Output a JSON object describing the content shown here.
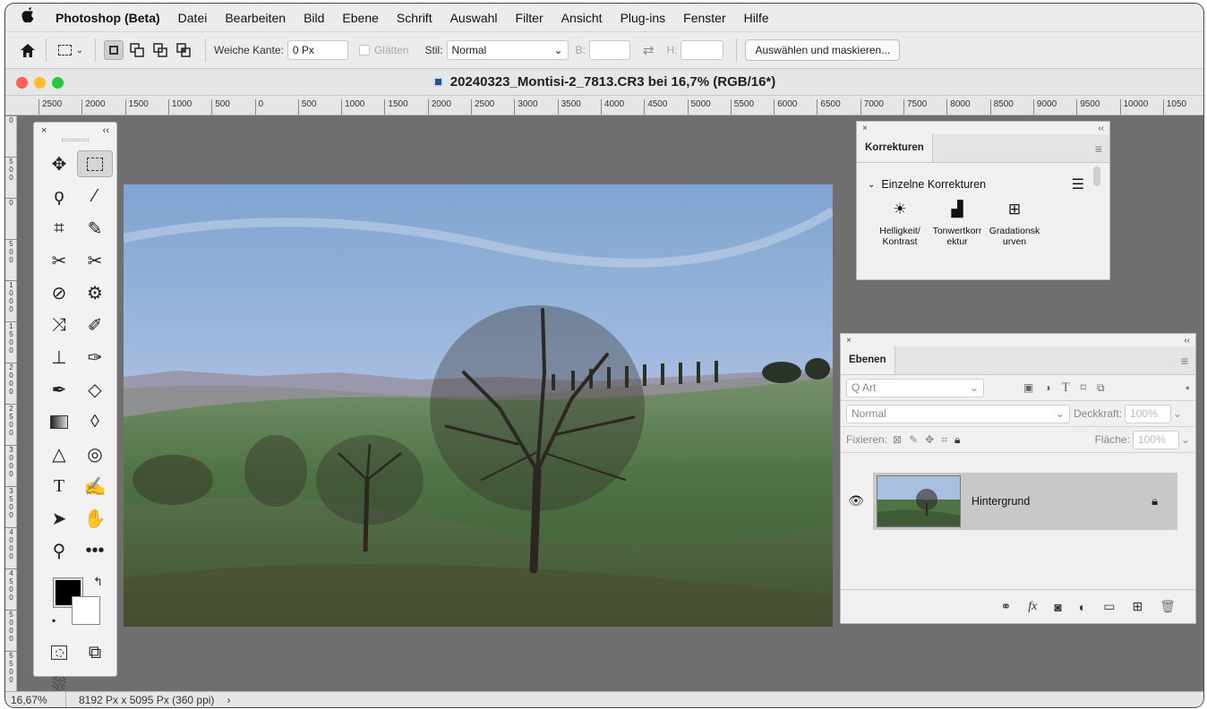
{
  "menubar": {
    "app_name": "Photoshop (Beta)",
    "items": [
      "Datei",
      "Bearbeiten",
      "Bild",
      "Ebene",
      "Schrift",
      "Auswahl",
      "Filter",
      "Ansicht",
      "Plug-ins",
      "Fenster",
      "Hilfe"
    ]
  },
  "options": {
    "soft_edge_label": "Weiche Kante:",
    "soft_edge_value": "0 Px",
    "antialias_label": "Glätten",
    "style_label": "Stil:",
    "style_value": "Normal",
    "width_label": "B:",
    "height_label": "H:",
    "select_mask_button": "Auswählen und maskieren..."
  },
  "document": {
    "title": "20240323_Montisi-2_7813.CR3 bei 16,7% (RGB/16*)"
  },
  "ruler": {
    "h": [
      "2500",
      "2000",
      "1500",
      "1000",
      "500",
      "0",
      "500",
      "1000",
      "1500",
      "2000",
      "2500",
      "3000",
      "3500",
      "4000",
      "4500",
      "5000",
      "5500",
      "6000",
      "6500",
      "7000",
      "7500",
      "8000",
      "8500",
      "9000",
      "9500",
      "10000",
      "1050"
    ],
    "v": [
      "0",
      "5\n0\n0",
      "0",
      "5\n0\n0",
      "1\n0\n0\n0",
      "1\n5\n0\n0",
      "2\n0\n0\n0",
      "2\n5\n0\n0",
      "3\n0\n0\n0",
      "3\n5\n0\n0",
      "4\n0\n0\n0",
      "4\n5\n0\n0",
      "5\n0\n0\n0",
      "5\n5\n0\n0"
    ]
  },
  "tools": {
    "close": "×",
    "collapse": "‹‹"
  },
  "status": {
    "zoom": "16,67%",
    "info": "8192 Px x 5095 Px (360 ppi)",
    "arrow": "›"
  },
  "adjustments": {
    "tab": "Korrekturen",
    "section": "Einzelne Korrekturen",
    "items": [
      {
        "label1": "Helligkeit/",
        "label2": "Kontrast"
      },
      {
        "label1": "Tonwertkorr",
        "label2": "ektur"
      },
      {
        "label1": "Gradationsk",
        "label2": "urven"
      }
    ]
  },
  "layers": {
    "tab": "Ebenen",
    "search_placeholder": "Q Art",
    "blend_mode": "Normal",
    "opacity_label": "Deckkraft:",
    "opacity_value": "100%",
    "lock_label": "Fixieren:",
    "fill_label": "Fläche:",
    "fill_value": "100%",
    "layer_name": "Hintergrund",
    "fx": "fx"
  },
  "colors": {
    "foreground": "#000000",
    "background": "#ffffff",
    "selected_layer": "#c8c8c8"
  }
}
